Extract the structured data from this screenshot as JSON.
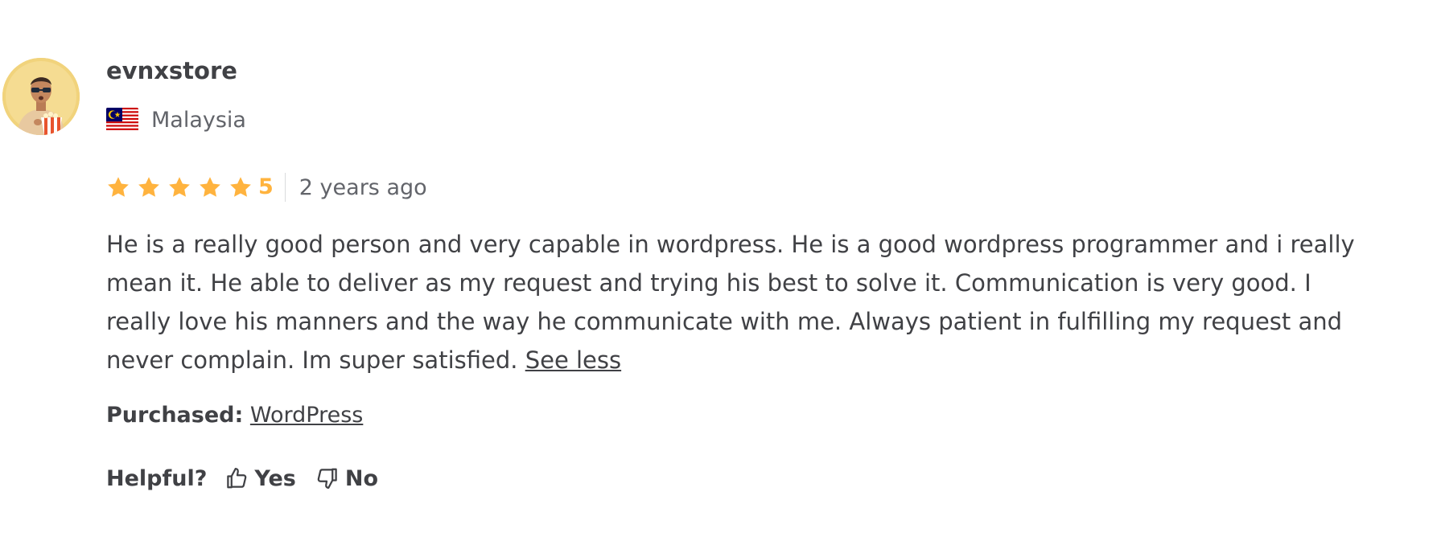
{
  "review": {
    "username": "evnxstore",
    "country": "Malaysia",
    "rating": {
      "stars": 5,
      "value_label": "5"
    },
    "time_ago": "2 years ago",
    "text": "He is a really good person and very capable in wordpress. He is a good wordpress programmer and i really mean it. He able to deliver as my request and trying his best to solve it. Communication is very good. I really love his manners and the way he communicate with me. Always patient in fulfilling my request and never complain. Im super satisfied.",
    "see_less_label": "See less",
    "purchased": {
      "label": "Purchased:",
      "item": "WordPress"
    },
    "helpful": {
      "label": "Helpful?",
      "yes_label": "Yes",
      "no_label": "No"
    }
  },
  "icons": {
    "star": "star-icon",
    "thumbs_up": "thumbs-up-icon",
    "thumbs_down": "thumbs-down-icon",
    "flag": "malaysia-flag-icon"
  },
  "colors": {
    "star": "#ffb33e",
    "text": "#404145",
    "muted": "#62646a",
    "divider": "#dadbdd"
  }
}
